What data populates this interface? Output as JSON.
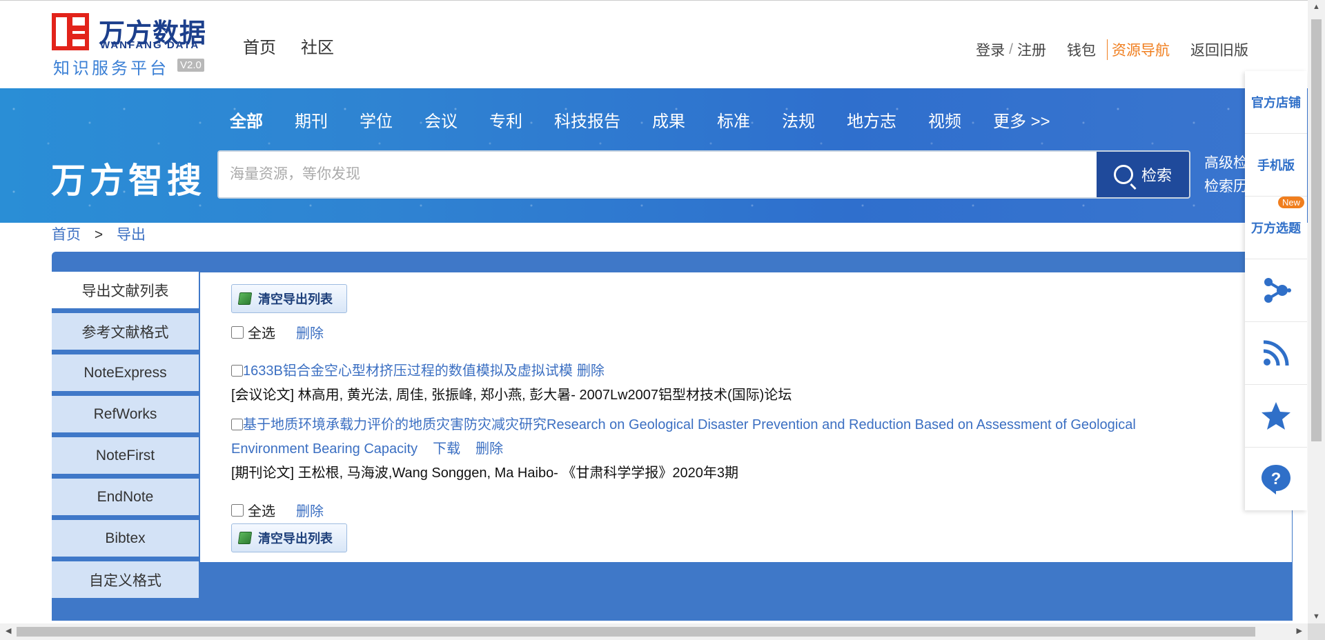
{
  "header": {
    "logo_cn": "万方数据",
    "logo_en": "WANFANG DATA",
    "logo_sub": "知识服务平台",
    "logo_version": "V2.0",
    "nav": [
      "首页",
      "社区"
    ],
    "user_links": {
      "login": "登录",
      "register": "注册",
      "wallet": "钱包",
      "resource_nav": "资源导航",
      "old_version": "返回旧版"
    }
  },
  "search": {
    "categories": [
      "全部",
      "期刊",
      "学位",
      "会议",
      "专利",
      "科技报告",
      "成果",
      "标准",
      "法规",
      "地方志",
      "视频",
      "更多 >>"
    ],
    "brand": "万方智搜",
    "placeholder": "海量资源，等你发现",
    "button_label": "检索",
    "advanced": "高级检",
    "history": "检索历"
  },
  "breadcrumb": {
    "home": "首页",
    "separator": ">",
    "current": "导出"
  },
  "tabs": [
    "导出文献列表",
    "参考文献格式",
    "NoteExpress",
    "RefWorks",
    "NoteFirst",
    "EndNote",
    "Bibtex",
    "自定义格式"
  ],
  "content": {
    "clear_label": "清空导出列表",
    "select_all": "全选",
    "delete": "删除",
    "items": [
      {
        "title": "1633B铝合金空心型材挤压过程的数值模拟及虚拟试模",
        "actions": [
          "删除"
        ],
        "meta": "[会议论文] 林高用, 黄光法, 周佳, 张振峰, 郑小燕, 彭大暑- 2007Lw2007铝型材技术(国际)论坛"
      },
      {
        "title": "基于地质环境承载力评价的地质灾害防灾减灾研究Research on Geological Disaster Prevention and Reduction Based on Assessment of Geological Environment Bearing Capacity",
        "actions": [
          "下载",
          "删除"
        ],
        "meta": "[期刊论文] 王松根, 马海波,Wang Songgen, Ma Haibo- 《甘肃科学学报》2020年3期"
      }
    ]
  },
  "floatbar": {
    "store": "官方店铺",
    "mobile": "手机版",
    "topics": "万方选题",
    "new_badge": "New",
    "icons": [
      "share-network-icon",
      "rss-icon",
      "star-icon",
      "help-icon"
    ]
  },
  "colors": {
    "brand_blue": "#3f78c8",
    "link_blue": "#3b6fc2",
    "accent_orange": "#f07e1e",
    "logo_red": "#e2231a"
  }
}
